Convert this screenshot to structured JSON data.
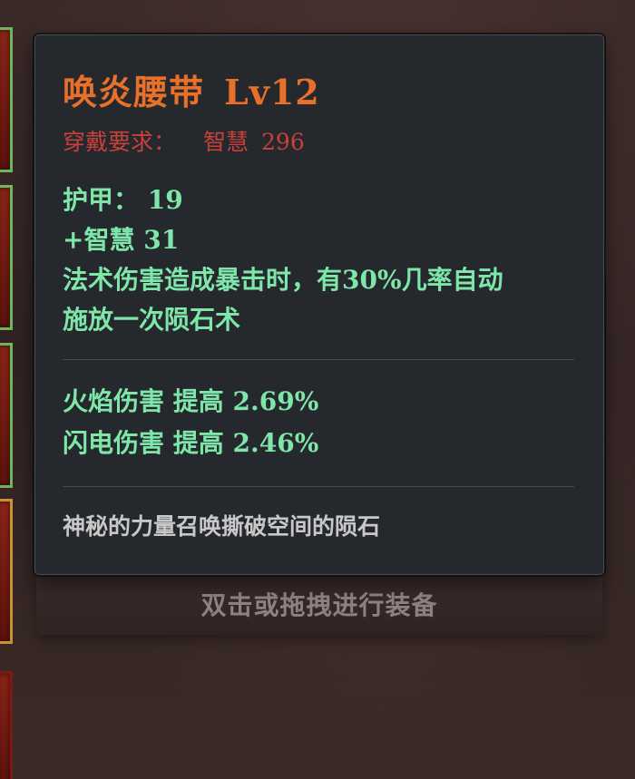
{
  "item": {
    "name": "唤炎腰带",
    "level": "Lv12",
    "requirement_label": "穿戴要求：",
    "requirement_stat": "智慧",
    "requirement_value": "296"
  },
  "base_stats": [
    "护甲：  19",
    "+智慧  31",
    "法术伤害造成暴击时，有30%几率自动",
    "施放一次陨石术"
  ],
  "bonus_stats": [
    "火焰伤害  提高  2.69%",
    "闪电伤害  提高  2.46%"
  ],
  "lore": "神秘的力量召唤撕破空间的陨石",
  "equip_hint": "双击或拖拽进行装备",
  "colors": {
    "title": "#e8702a",
    "requirement": "#c8403a",
    "stats": "#7de6a8",
    "lore": "#c8c8c8",
    "tooltip_bg": "#25282c"
  }
}
